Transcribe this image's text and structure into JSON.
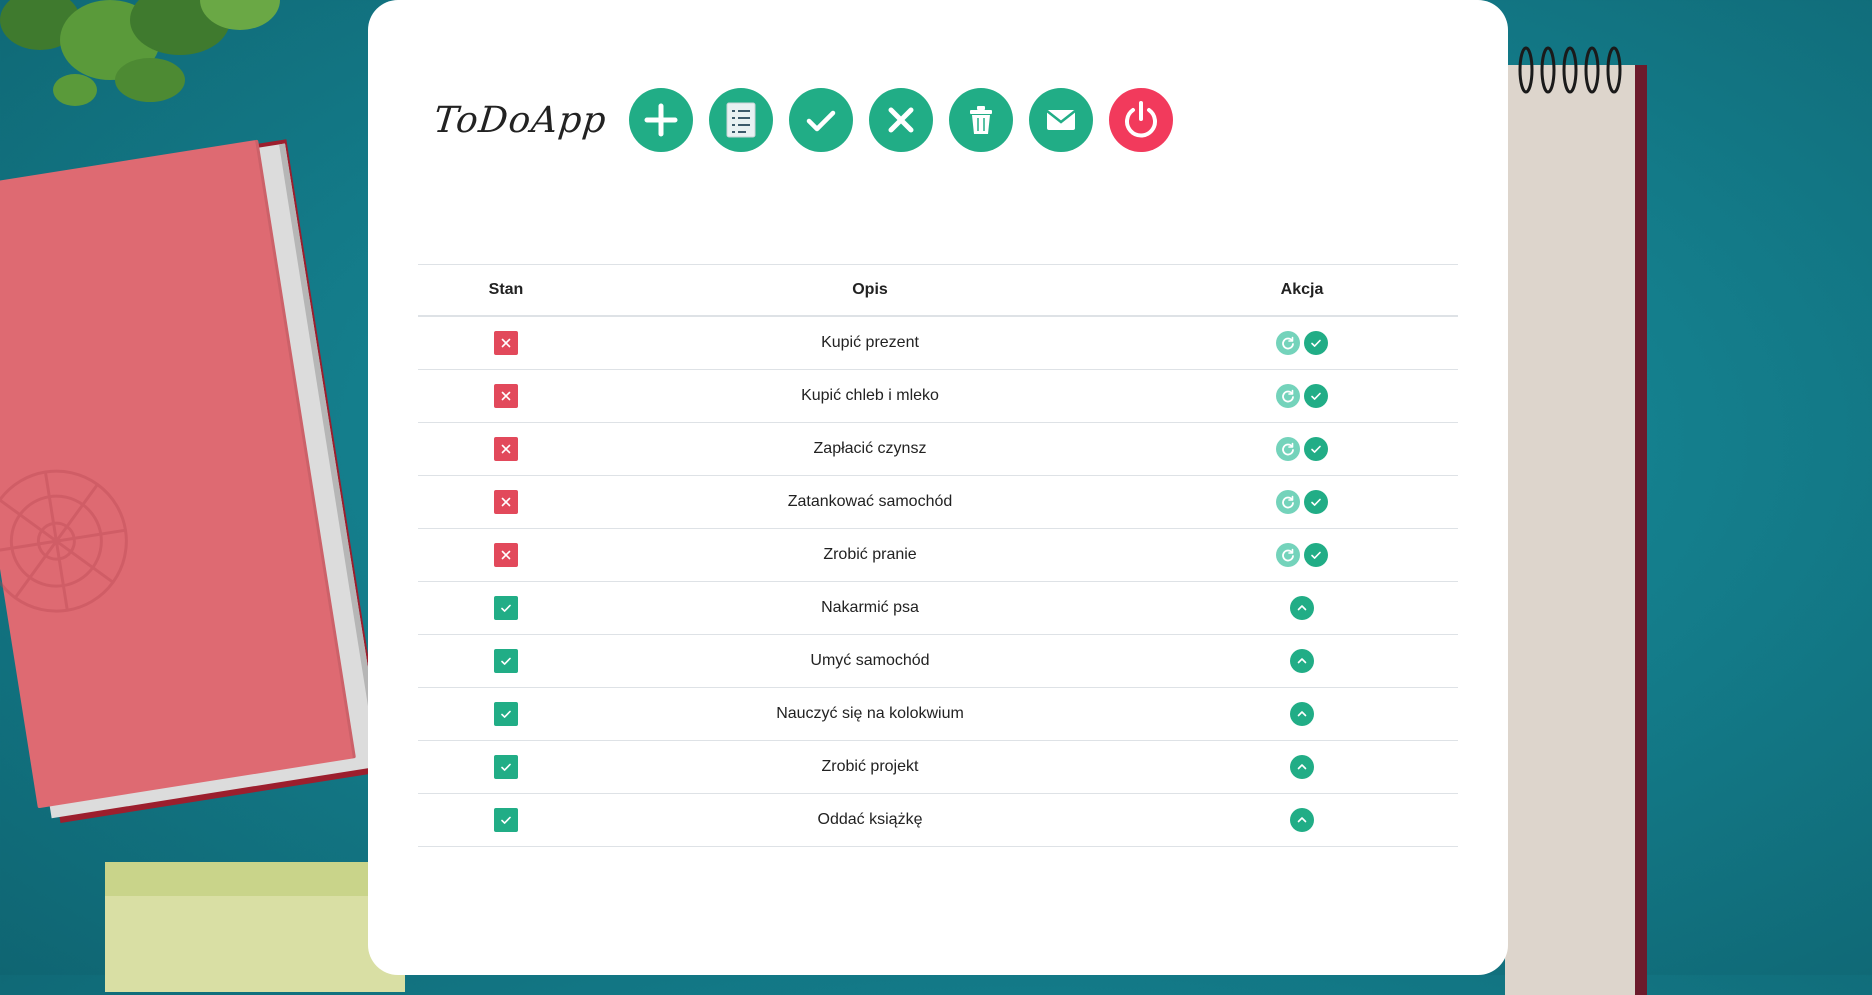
{
  "app": {
    "title": "ToDoApp"
  },
  "toolbar": [
    {
      "icon": "plus-icon",
      "name": "add-button"
    },
    {
      "icon": "list-icon",
      "name": "list-button"
    },
    {
      "icon": "check-icon",
      "name": "done-filter-button"
    },
    {
      "icon": "close-icon",
      "name": "undone-filter-button"
    },
    {
      "icon": "trash-icon",
      "name": "delete-button"
    },
    {
      "icon": "mail-icon",
      "name": "mail-button"
    },
    {
      "icon": "power-icon",
      "name": "logout-button"
    }
  ],
  "colors": {
    "accent": "#21ad86",
    "danger": "#e2495b",
    "power": "#f23a5c",
    "light_accent": "#74d3bb"
  },
  "table": {
    "headers": {
      "stan": "Stan",
      "opis": "Opis",
      "akcja": "Akcja"
    },
    "rows": [
      {
        "done": false,
        "text": "Kupić prezent"
      },
      {
        "done": false,
        "text": "Kupić chleb i mleko"
      },
      {
        "done": false,
        "text": "Zapłacić czynsz"
      },
      {
        "done": false,
        "text": "Zatankować samochód"
      },
      {
        "done": false,
        "text": "Zrobić pranie"
      },
      {
        "done": true,
        "text": "Nakarmić psa"
      },
      {
        "done": true,
        "text": "Umyć samochód"
      },
      {
        "done": true,
        "text": "Nauczyć się na kolokwium"
      },
      {
        "done": true,
        "text": "Zrobić projekt"
      },
      {
        "done": true,
        "text": "Oddać książkę"
      }
    ]
  }
}
